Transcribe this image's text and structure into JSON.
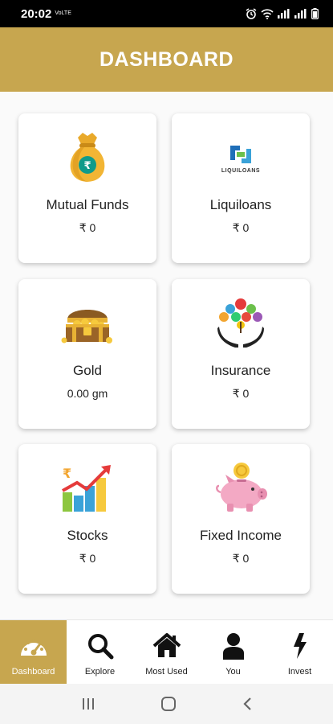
{
  "status_bar": {
    "time": "20:02",
    "carrier_tag": "VoLTE"
  },
  "header": {
    "title": "DASHBOARD"
  },
  "cards": [
    {
      "title": "Mutual Funds",
      "value": "₹ 0",
      "icon": "money-bag-icon"
    },
    {
      "title": "Liquiloans",
      "value": "₹ 0",
      "icon": "liquiloans-logo",
      "logo_text": "LIQUILOANS"
    },
    {
      "title": "Gold",
      "value": "0.00 gm",
      "icon": "treasure-chest-icon"
    },
    {
      "title": "Insurance",
      "value": "₹ 0",
      "icon": "insurance-hands-icon"
    },
    {
      "title": "Stocks",
      "value": "₹ 0",
      "icon": "stocks-chart-icon"
    },
    {
      "title": "Fixed Income",
      "value": "₹ 0",
      "icon": "piggy-bank-icon"
    }
  ],
  "bottom_nav": [
    {
      "label": "Dashboard",
      "icon": "speedometer-icon",
      "active": true
    },
    {
      "label": "Explore",
      "icon": "search-icon",
      "active": false
    },
    {
      "label": "Most Used",
      "icon": "home-icon",
      "active": false
    },
    {
      "label": "You",
      "icon": "user-icon",
      "active": false
    },
    {
      "label": "Invest",
      "icon": "lightning-icon",
      "active": false
    }
  ],
  "colors": {
    "brand": "#c7a64f",
    "header_text": "#ffffff",
    "card_bg": "#ffffff"
  }
}
